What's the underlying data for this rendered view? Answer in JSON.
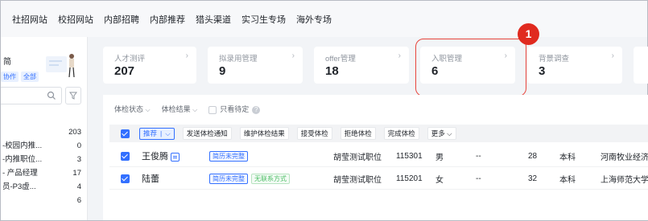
{
  "topnav": [
    "社招网站",
    "校招网站",
    "内部招聘",
    "内部推荐",
    "猎头渠道",
    "实习生专场",
    "海外专场"
  ],
  "left": {
    "title": "简",
    "tags": [
      "协作",
      "全部"
    ],
    "rows": [
      {
        "label": "",
        "count": "203"
      },
      {
        "label": "-校园内推...",
        "count": "0"
      },
      {
        "label": "-内推职位...",
        "count": "3"
      },
      {
        "label": "- 产品经理",
        "count": "17"
      },
      {
        "label": "员-P3虚...",
        "count": "4"
      },
      {
        "label": "",
        "count": "6"
      }
    ]
  },
  "cards": [
    {
      "label": "人才测评",
      "value": "207"
    },
    {
      "label": "拟录用管理",
      "value": "9"
    },
    {
      "label": "offer管理",
      "value": "18"
    },
    {
      "label": "入职管理",
      "value": "6"
    },
    {
      "label": "背景调查",
      "value": "3"
    }
  ],
  "badge": "1",
  "filters": {
    "status": "体检状态",
    "result": "体检结果",
    "pending_only": "只看待定"
  },
  "actions": {
    "recommend": "推荐",
    "items": [
      "发送体检通知",
      "维护体检结果",
      "接受体检",
      "拒绝体检",
      "完成体检",
      "更多"
    ]
  },
  "rows": [
    {
      "name": "王俊腾",
      "tags": [
        "简历未完整"
      ],
      "position": "胡莹测试职位",
      "id": "115301",
      "gender": "男",
      "dash": "--",
      "age": "28",
      "edu": "本科",
      "school": "河南牧业经济学"
    },
    {
      "name": "陆蕾",
      "tags": [
        "简历未完整",
        "无联系方式"
      ],
      "position": "胡莹测试职位",
      "id": "115201",
      "gender": "女",
      "dash": "--",
      "age": "32",
      "edu": "本科",
      "school": "上海师范大学天"
    }
  ]
}
